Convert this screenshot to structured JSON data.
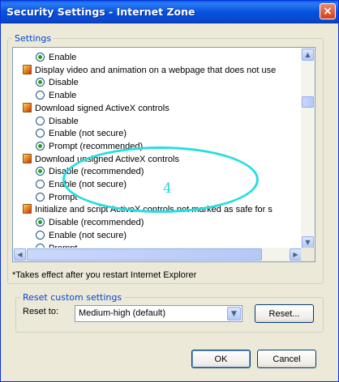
{
  "window": {
    "title": "Security Settings - Internet Zone",
    "close_glyph": "×"
  },
  "settings": {
    "legend": "Settings",
    "rows": [
      {
        "kind": "option",
        "label": "Enable",
        "checked": true
      },
      {
        "kind": "category",
        "label": "Display video and animation on a webpage that does not use"
      },
      {
        "kind": "option",
        "label": "Disable",
        "checked": true
      },
      {
        "kind": "option",
        "label": "Enable",
        "checked": false
      },
      {
        "kind": "category",
        "label": "Download signed ActiveX controls"
      },
      {
        "kind": "option",
        "label": "Disable",
        "checked": false
      },
      {
        "kind": "option",
        "label": "Enable (not secure)",
        "checked": false
      },
      {
        "kind": "option",
        "label": "Prompt (recommended)",
        "checked": true
      },
      {
        "kind": "category",
        "label": "Download unsigned ActiveX controls"
      },
      {
        "kind": "option",
        "label": "Disable (recommended)",
        "checked": true
      },
      {
        "kind": "option",
        "label": "Enable (not secure)",
        "checked": false
      },
      {
        "kind": "option",
        "label": "Prompt",
        "checked": false
      },
      {
        "kind": "category",
        "label": "Initialize and script ActiveX controls not marked as safe for s"
      },
      {
        "kind": "option",
        "label": "Disable (recommended)",
        "checked": true
      },
      {
        "kind": "option",
        "label": "Enable (not secure)",
        "checked": false
      },
      {
        "kind": "option",
        "label": "Prompt",
        "checked": false
      }
    ]
  },
  "note": "*Takes effect after you restart Internet Explorer",
  "reset": {
    "legend": "Reset custom settings",
    "label": "Reset to:",
    "value": "Medium-high (default)",
    "button": "Reset..."
  },
  "buttons": {
    "ok": "OK",
    "cancel": "Cancel"
  },
  "annotation": {
    "number": "4",
    "color": "#28dde0"
  },
  "icons": {
    "close": "close-icon",
    "setting": "setting-group-icon",
    "up": "scroll-up-icon",
    "down": "scroll-down-icon",
    "left": "scroll-left-icon",
    "right": "scroll-right-icon",
    "dropdown": "chevron-down-icon"
  }
}
